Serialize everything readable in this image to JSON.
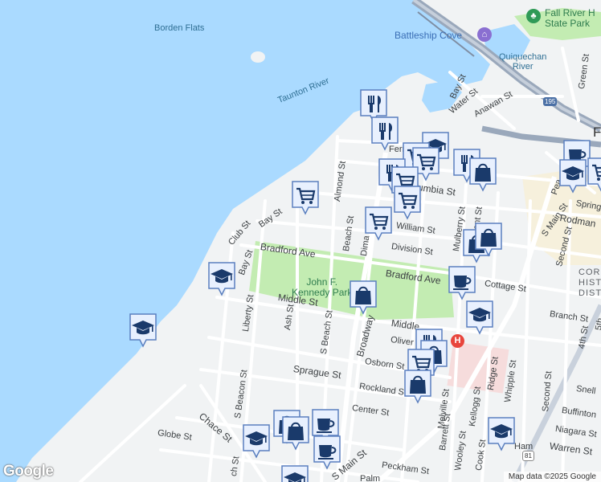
{
  "colors": {
    "water": "#aadaff",
    "land": "#f1f3f4",
    "park": "#c3ecb2",
    "road": "#ffffff",
    "highway": "#9aa8bb",
    "pin_fill": "#e8f0fe",
    "pin_border": "#5a7fbf",
    "icon": "#1a3a6b",
    "hospital": "#e8453c"
  },
  "labels": {
    "borden_flats": "Borden Flats",
    "taunton_river": "Taunton River",
    "battleship_cove": "Battleship Cove",
    "fall_river_park": "Fall River H\nState Park",
    "quiquechan": "Quiquechan\nRiver",
    "jfk_park": "John F.\nKennedy Park",
    "bradford_ave": "Bradford Ave",
    "bradford_ave_2": "Bradford Ave",
    "middle_st": "Middle St",
    "middle_st_2": "Middle",
    "bay_st": "Bay St",
    "club_st": "Club St",
    "bay_st_2": "Bay St",
    "almond_st": "Almond St",
    "beach_st": "Beach St",
    "dima": "Dima",
    "william_st": "William St",
    "division_st": "Division St",
    "columbia_st": "umbia St",
    "mulberry_st": "Mulberry St",
    "grant_st": "ant St",
    "water_st": "Water St",
    "anawan_st": "Anawan St",
    "bay_st_top": "Bay St",
    "ferry": "Ferr",
    "cottage_st": "Cottage St",
    "s_main_st": "S Main St",
    "second_st_top": "Second St",
    "spring": "Spring",
    "rodman": "Rodman",
    "pea": "Pea",
    "corky": "CORK\nHIST\nDIST",
    "branch_st": "Branch St",
    "oliver_st": "Oliver St",
    "osborn_st": "Osborn St",
    "sprague_st": "Sprague St",
    "rockland_st": "Rockland St",
    "center_st": "Center St",
    "globe_st": "Globe St",
    "chace_st": "Chace St",
    "liberty_st": "Liberty St",
    "ash_st": "Ash St",
    "s_beach_st": "S Beach St",
    "broadway": "Broadway",
    "s_beacon_st": "S Beacon St",
    "melville_st": "Melville St",
    "barrett_st": "Barrett St",
    "kellogg_st": "Kellogg St",
    "ridge_st": "Ridge St",
    "whipple_st": "Whipple St",
    "second_st": "Second St",
    "woolsey_st": "Wooley St",
    "cook_st": "Cook St",
    "snell": "Snell",
    "buffinton": "Buffinton",
    "niagara": "Niagara St",
    "warren": "Warren St",
    "peckham": "Peckham St",
    "s_main_bottom": "S Main St",
    "fourth_st": "4th St",
    "fifth_st": "5th",
    "green_st": "Green St",
    "ham": "Ham",
    "palm": "Palm",
    "ch_st": "ch St",
    "f_edge": "F",
    "route_195": "195",
    "route_81": "81"
  },
  "pins": [
    {
      "type": "restaurant",
      "icon": "fork-knife-icon"
    },
    {
      "type": "restaurant",
      "icon": "fork-knife-icon"
    },
    {
      "type": "grocery",
      "icon": "cart-icon"
    },
    {
      "type": "school",
      "icon": "school-icon"
    },
    {
      "type": "grocery",
      "icon": "cart-icon"
    },
    {
      "type": "grocery",
      "icon": "cart-icon"
    },
    {
      "type": "restaurant",
      "icon": "fork-knife-icon"
    },
    {
      "type": "grocery",
      "icon": "cart-icon"
    },
    {
      "type": "grocery",
      "icon": "cart-icon"
    },
    {
      "type": "restaurant",
      "icon": "fork-knife-icon"
    },
    {
      "type": "shopping",
      "icon": "shopping-bag-icon"
    },
    {
      "type": "cafe",
      "icon": "coffee-cup-icon"
    },
    {
      "type": "school",
      "icon": "school-icon"
    },
    {
      "type": "grocery",
      "icon": "cart-icon"
    },
    {
      "type": "grocery",
      "icon": "cart-icon"
    },
    {
      "type": "shopping",
      "icon": "shopping-bag-icon"
    },
    {
      "type": "shopping",
      "icon": "shopping-bag-icon"
    },
    {
      "type": "cafe",
      "icon": "coffee-cup-icon"
    },
    {
      "type": "school",
      "icon": "school-icon"
    },
    {
      "type": "shopping",
      "icon": "shopping-bag-icon"
    },
    {
      "type": "school",
      "icon": "school-icon"
    },
    {
      "type": "school",
      "icon": "school-icon"
    },
    {
      "type": "restaurant",
      "icon": "fork-knife-icon"
    },
    {
      "type": "shopping",
      "icon": "shopping-bag-icon"
    },
    {
      "type": "grocery",
      "icon": "cart-icon"
    },
    {
      "type": "shopping",
      "icon": "shopping-bag-icon"
    },
    {
      "type": "school",
      "icon": "school-icon"
    },
    {
      "type": "school",
      "icon": "school-icon"
    },
    {
      "type": "shopping",
      "icon": "shopping-bag-icon"
    },
    {
      "type": "shopping",
      "icon": "shopping-bag-icon"
    },
    {
      "type": "cafe",
      "icon": "coffee-cup-icon"
    },
    {
      "type": "cafe",
      "icon": "coffee-cup-icon"
    },
    {
      "type": "school",
      "icon": "school-icon"
    }
  ],
  "branding": {
    "logo": "Google",
    "credit": "Map data ©2025 Google"
  }
}
